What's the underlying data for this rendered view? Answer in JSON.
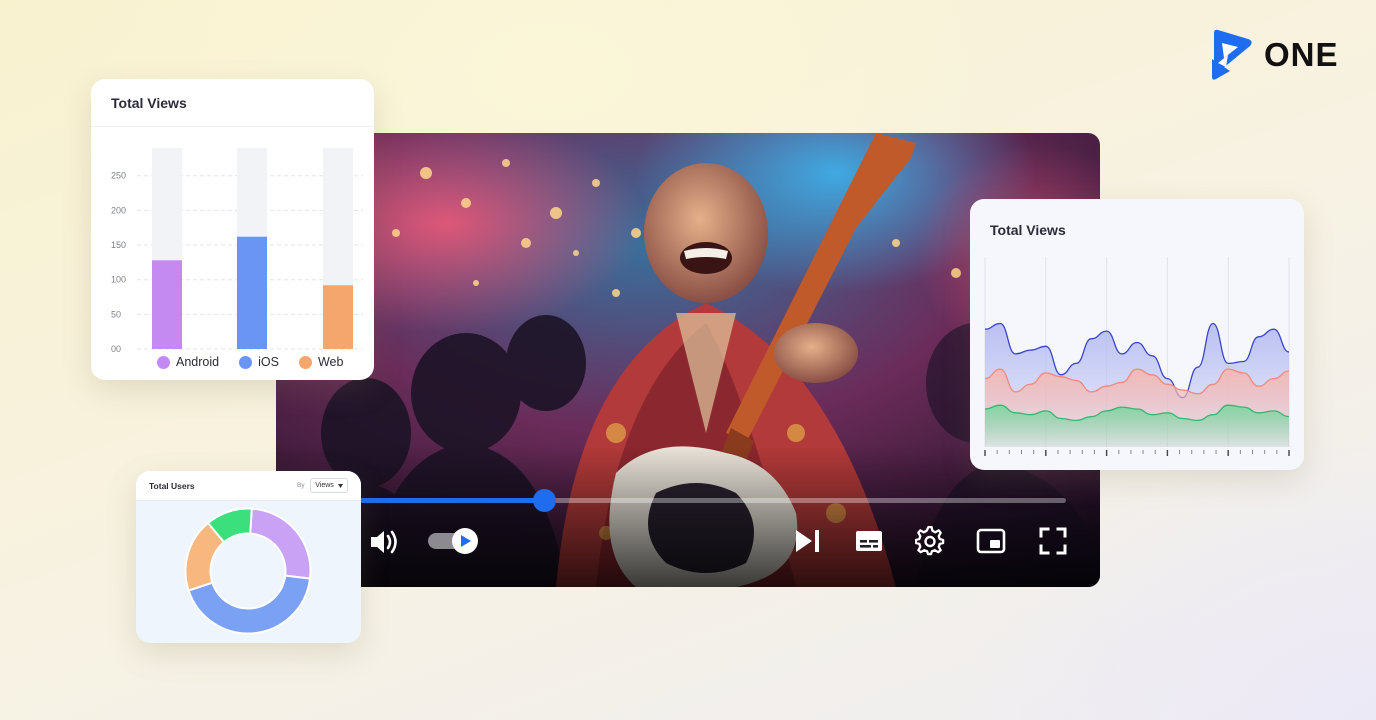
{
  "brand": {
    "name": "ONE",
    "color": "#1e6cf0"
  },
  "player": {
    "progress": 0.26,
    "controls": [
      "volume-icon",
      "autoplay-toggle",
      "skip-next-icon",
      "subtitles-icon",
      "settings-gear-icon",
      "picture-in-picture-icon",
      "fullscreen-icon"
    ]
  },
  "total_views_bar": {
    "title": "Total Views",
    "chart_data": {
      "type": "bar",
      "categories": [
        "Android",
        "iOS",
        "Web"
      ],
      "values": [
        128,
        162,
        92
      ],
      "ylim": [
        0,
        290
      ],
      "ytick_labels": [
        "00",
        "50",
        "100",
        "150",
        "200",
        "250"
      ],
      "ytick_values": [
        0,
        50,
        100,
        150,
        200,
        250
      ],
      "colors": [
        "#c58af2",
        "#6a95f5",
        "#f4a66c"
      ],
      "legend": [
        "Android",
        "iOS",
        "Web"
      ],
      "grid": true,
      "legend_position": "bottom"
    }
  },
  "total_views_area": {
    "title": "Total Views",
    "chart_data": {
      "type": "area",
      "x": [
        0,
        1,
        2,
        3,
        4,
        5,
        6,
        7,
        8,
        9,
        10,
        11,
        12,
        13,
        14,
        15,
        16,
        17,
        18,
        19,
        20
      ],
      "ylim": [
        0,
        100
      ],
      "series": [
        {
          "values": [
            62,
            65,
            49,
            51,
            53,
            38,
            44,
            57,
            61,
            49,
            55,
            48,
            36,
            26,
            42,
            65,
            44,
            45,
            58,
            62,
            50
          ],
          "color": "#3a46c9",
          "fill": "#b7bdf1"
        },
        {
          "values": [
            36,
            41,
            29,
            33,
            39,
            37,
            35,
            29,
            32,
            34,
            41,
            38,
            33,
            30,
            28,
            33,
            41,
            39,
            32,
            36,
            40
          ],
          "color": "#f08a7f",
          "fill": "#f3b9b4"
        },
        {
          "values": [
            20,
            22,
            18,
            17,
            19,
            15,
            14,
            16,
            19,
            21,
            20,
            17,
            18,
            15,
            14,
            17,
            22,
            21,
            18,
            19,
            16
          ],
          "color": "#3ab56e",
          "fill": "#7fd6a3"
        }
      ],
      "grid": true
    }
  },
  "total_users": {
    "title": "Total Users",
    "by_label": "By",
    "select_value": "Views",
    "chart_data": {
      "type": "pie",
      "labels": [
        "",
        "",
        "",
        ""
      ],
      "values": [
        26,
        43,
        19,
        12
      ],
      "colors": [
        "#c9a2f6",
        "#7ba1f5",
        "#f8b77e",
        "#3be07d"
      ]
    }
  }
}
